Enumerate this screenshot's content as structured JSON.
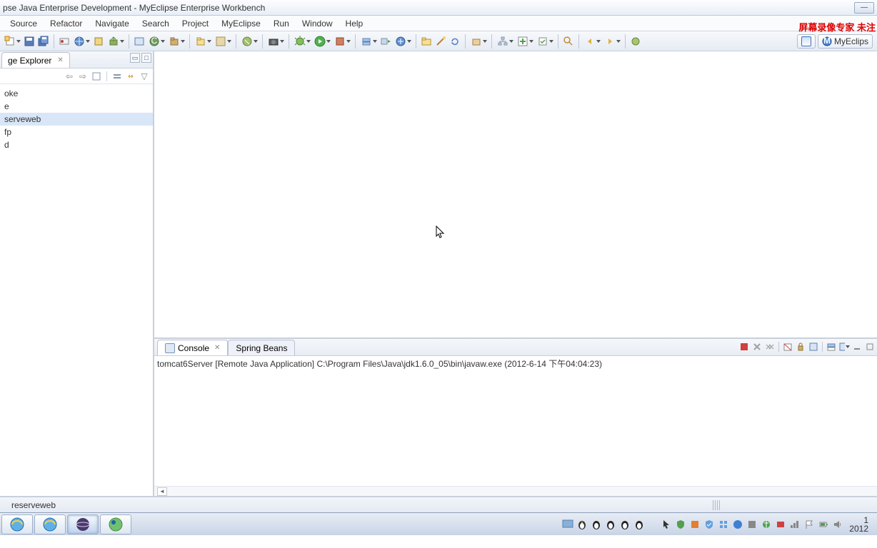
{
  "window": {
    "title": "pse Java Enterprise Development - MyEclipse Enterprise Workbench"
  },
  "watermark": "屏幕录像专家 未注",
  "menu": {
    "source": "Source",
    "refactor": "Refactor",
    "navigate": "Navigate",
    "search": "Search",
    "project": "Project",
    "myeclipse": "MyEclipse",
    "run": "Run",
    "window": "Window",
    "help": "Help"
  },
  "perspective": {
    "label": "MyEclips"
  },
  "explorer": {
    "title": "ge Explorer",
    "items": [
      "oke",
      "e",
      "serveweb",
      "fp",
      "d"
    ]
  },
  "console": {
    "tab1": "Console",
    "tab2": "Spring Beans",
    "line": "tomcat6Server [Remote Java Application] C:\\Program Files\\Java\\jdk1.6.0_05\\bin\\javaw.exe (2012-6-14 下午04:04:23)"
  },
  "status": {
    "text": "reserveweb"
  },
  "clock": {
    "time": "1",
    "date": "2012"
  }
}
